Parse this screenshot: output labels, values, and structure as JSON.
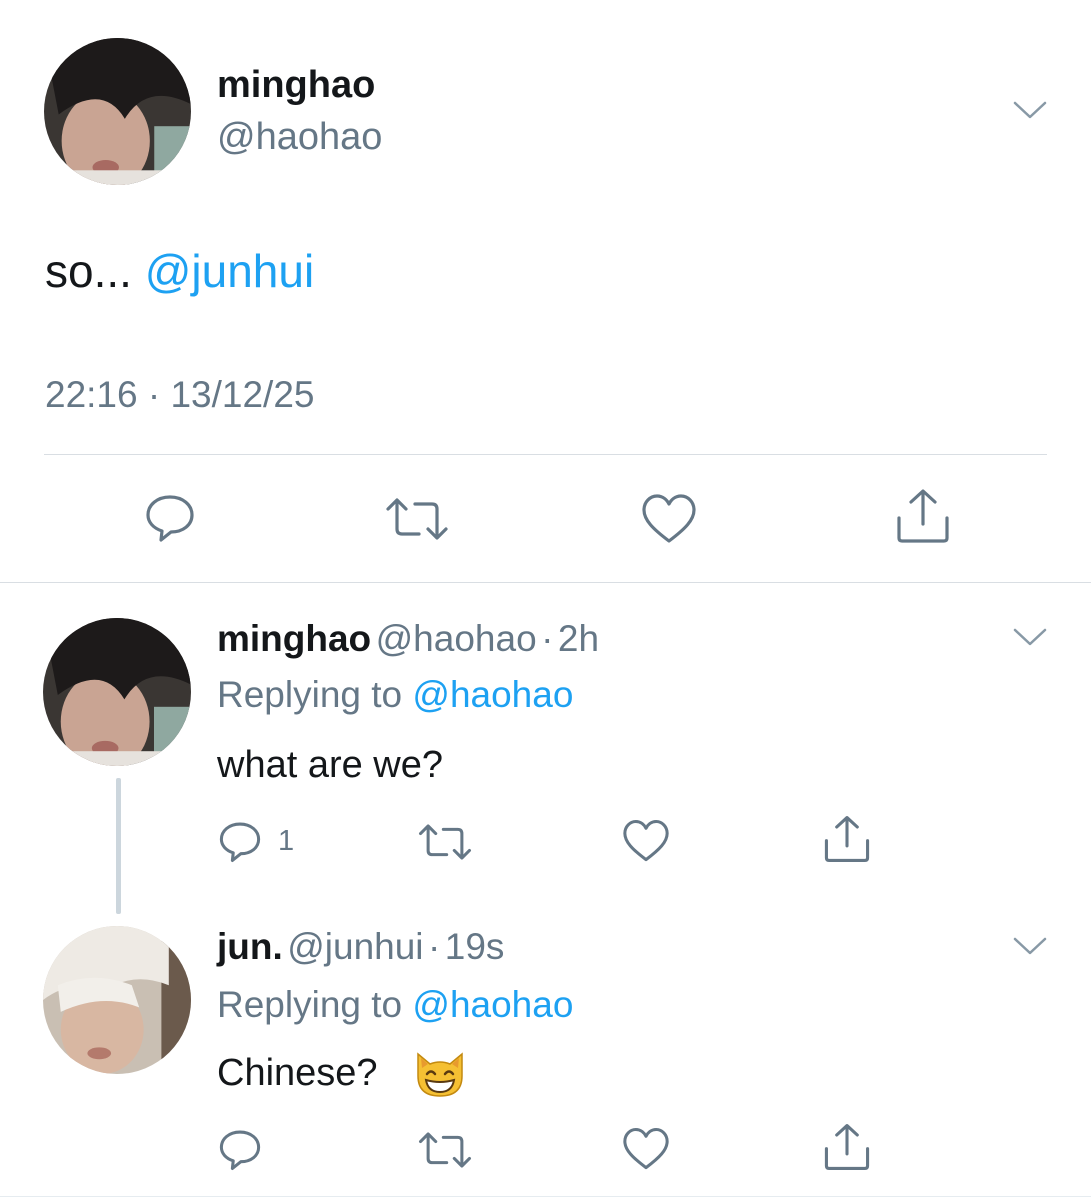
{
  "main_tweet": {
    "author_name": "minghao",
    "author_handle": "@haohao",
    "text_prefix": "so...",
    "text_mention": "@junhui",
    "timestamp": "22:16 · 13/12/25"
  },
  "replies": [
    {
      "author_name": "minghao",
      "author_handle": "@haohao",
      "separator": "·",
      "age": "2h",
      "replying_prefix": "Replying to",
      "replying_to": "@haohao",
      "text": "what are we?",
      "reply_count": "1"
    },
    {
      "author_name": "jun.",
      "author_handle": "@junhui",
      "separator": "·",
      "age": "19s",
      "replying_prefix": "Replying to",
      "replying_to": "@haohao",
      "text": "Chinese?",
      "emoji": "grinning-cat-face"
    }
  ],
  "colors": {
    "accent": "#1da1f2",
    "secondary_text": "#657786",
    "primary_text": "#14171a",
    "icon": "#657786",
    "divider": "#d9dee3"
  }
}
